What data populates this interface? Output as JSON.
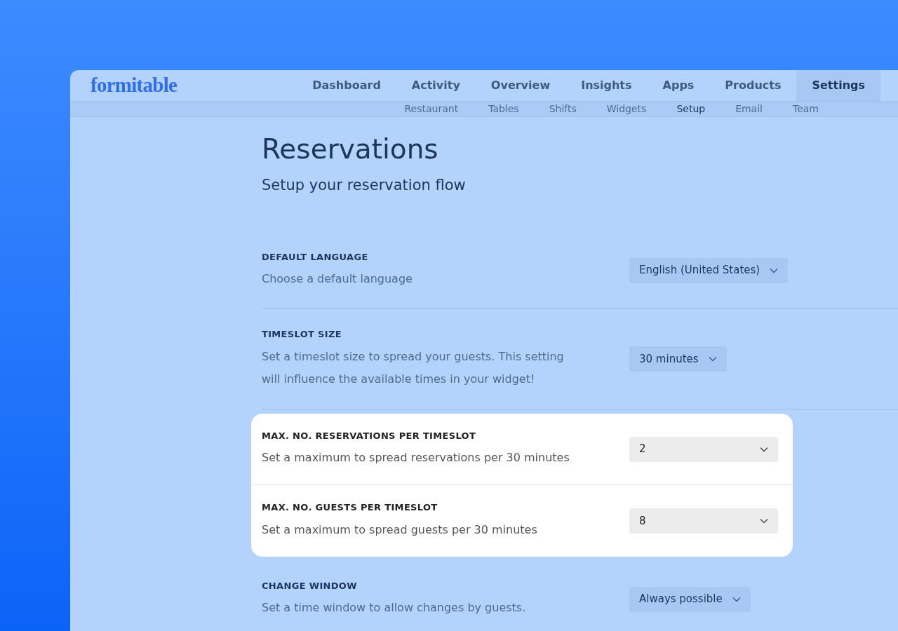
{
  "logo": "formitable",
  "nav": [
    {
      "label": "Dashboard",
      "selected": false
    },
    {
      "label": "Activity",
      "selected": false
    },
    {
      "label": "Overview",
      "selected": false
    },
    {
      "label": "Insights",
      "selected": false
    },
    {
      "label": "Apps",
      "selected": false
    },
    {
      "label": "Products",
      "selected": false
    },
    {
      "label": "Settings",
      "selected": true
    }
  ],
  "subnav": [
    {
      "label": "Restaurant",
      "selected": false
    },
    {
      "label": "Tables",
      "selected": false
    },
    {
      "label": "Shifts",
      "selected": false
    },
    {
      "label": "Widgets",
      "selected": false
    },
    {
      "label": "Setup",
      "selected": true
    },
    {
      "label": "Email",
      "selected": false
    },
    {
      "label": "Team",
      "selected": false
    }
  ],
  "title": "Reservations",
  "subtitle": "Setup your reservation flow",
  "settings": [
    {
      "label": "DEFAULT LANGUAGE",
      "description": "Choose a default language",
      "value": "English (United States)",
      "highlighted": false
    },
    {
      "label": "TIMESLOT SIZE",
      "description": "Set a timeslot size to spread your guests. This setting will influence the available times in your widget!",
      "value": "30 minutes",
      "highlighted": false
    },
    {
      "label": "MAX. NO. RESERVATIONS PER TIMESLOT",
      "description": "Set a maximum to spread reservations per 30 minutes",
      "value": "2",
      "highlighted": true
    },
    {
      "label": "MAX. NO. GUESTS PER TIMESLOT",
      "description": "Set a maximum to spread guests per 30 minutes",
      "value": "8",
      "highlighted": true
    },
    {
      "label": "CHANGE WINDOW",
      "description": "Set a time window to allow changes by guests.",
      "value": "Always possible",
      "highlighted": false
    }
  ]
}
